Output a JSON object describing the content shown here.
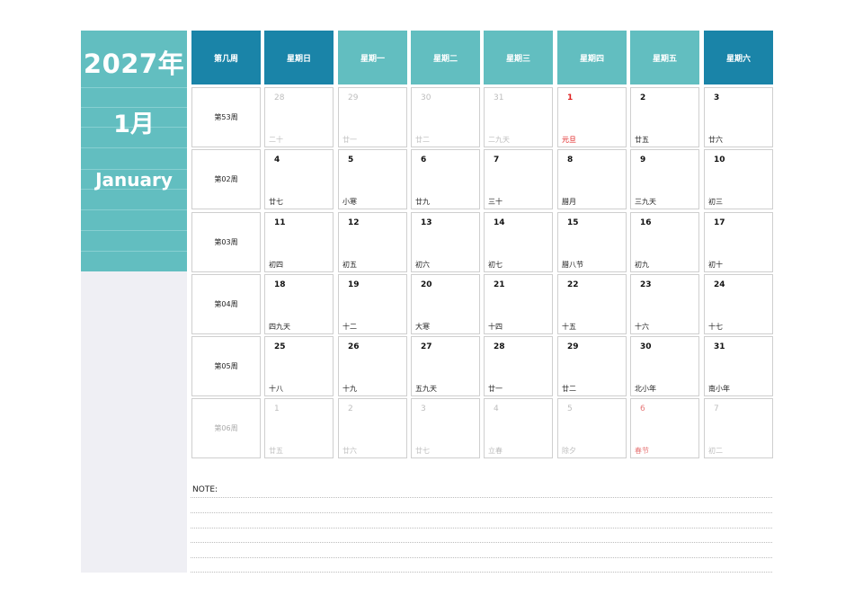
{
  "sidebar": {
    "year": "2027年",
    "month_cn": "1月",
    "month_en": "January"
  },
  "headers": [
    "第几周",
    "星期日",
    "星期一",
    "星期二",
    "星期三",
    "星期四",
    "星期五",
    "星期六"
  ],
  "colors": {
    "header_dark": "#1a84a8",
    "header_light": "#62bec0",
    "sidebar": "#62bec0",
    "sidebar_bottom": "#efeff4",
    "holiday_red": "#e02020"
  },
  "weeks": [
    {
      "label": "第53周",
      "dim": false,
      "days": [
        {
          "d": "28",
          "l": "二十",
          "dim": true
        },
        {
          "d": "29",
          "l": "廿一",
          "dim": true
        },
        {
          "d": "30",
          "l": "廿二",
          "dim": true
        },
        {
          "d": "31",
          "l": "二九天",
          "dim": true
        },
        {
          "d": "1",
          "l": "元旦",
          "red": true
        },
        {
          "d": "2",
          "l": "廿五"
        },
        {
          "d": "3",
          "l": "廿六"
        }
      ]
    },
    {
      "label": "第02周",
      "dim": false,
      "days": [
        {
          "d": "4",
          "l": "廿七"
        },
        {
          "d": "5",
          "l": "小寒"
        },
        {
          "d": "6",
          "l": "廿九"
        },
        {
          "d": "7",
          "l": "三十"
        },
        {
          "d": "8",
          "l": "腊月"
        },
        {
          "d": "9",
          "l": "三九天"
        },
        {
          "d": "10",
          "l": "初三"
        }
      ]
    },
    {
      "label": "第03周",
      "dim": false,
      "days": [
        {
          "d": "11",
          "l": "初四"
        },
        {
          "d": "12",
          "l": "初五"
        },
        {
          "d": "13",
          "l": "初六"
        },
        {
          "d": "14",
          "l": "初七"
        },
        {
          "d": "15",
          "l": "腊八节"
        },
        {
          "d": "16",
          "l": "初九"
        },
        {
          "d": "17",
          "l": "初十"
        }
      ]
    },
    {
      "label": "第04周",
      "dim": false,
      "days": [
        {
          "d": "18",
          "l": "四九天"
        },
        {
          "d": "19",
          "l": "十二"
        },
        {
          "d": "20",
          "l": "大寒"
        },
        {
          "d": "21",
          "l": "十四"
        },
        {
          "d": "22",
          "l": "十五"
        },
        {
          "d": "23",
          "l": "十六"
        },
        {
          "d": "24",
          "l": "十七"
        }
      ]
    },
    {
      "label": "第05周",
      "dim": false,
      "days": [
        {
          "d": "25",
          "l": "十八"
        },
        {
          "d": "26",
          "l": "十九"
        },
        {
          "d": "27",
          "l": "五九天"
        },
        {
          "d": "28",
          "l": "廿一"
        },
        {
          "d": "29",
          "l": "廿二"
        },
        {
          "d": "30",
          "l": "北小年"
        },
        {
          "d": "31",
          "l": "南小年"
        }
      ]
    },
    {
      "label": "第06周",
      "dim": true,
      "days": [
        {
          "d": "1",
          "l": "廿五",
          "dim": true
        },
        {
          "d": "2",
          "l": "廿六",
          "dim": true
        },
        {
          "d": "3",
          "l": "廿七",
          "dim": true
        },
        {
          "d": "4",
          "l": "立春",
          "dim": true
        },
        {
          "d": "5",
          "l": "除夕",
          "dim": true
        },
        {
          "d": "6",
          "l": "春节",
          "dim": true,
          "red": true
        },
        {
          "d": "7",
          "l": "初二",
          "dim": true
        }
      ]
    }
  ],
  "note": {
    "label": "NOTE:"
  }
}
